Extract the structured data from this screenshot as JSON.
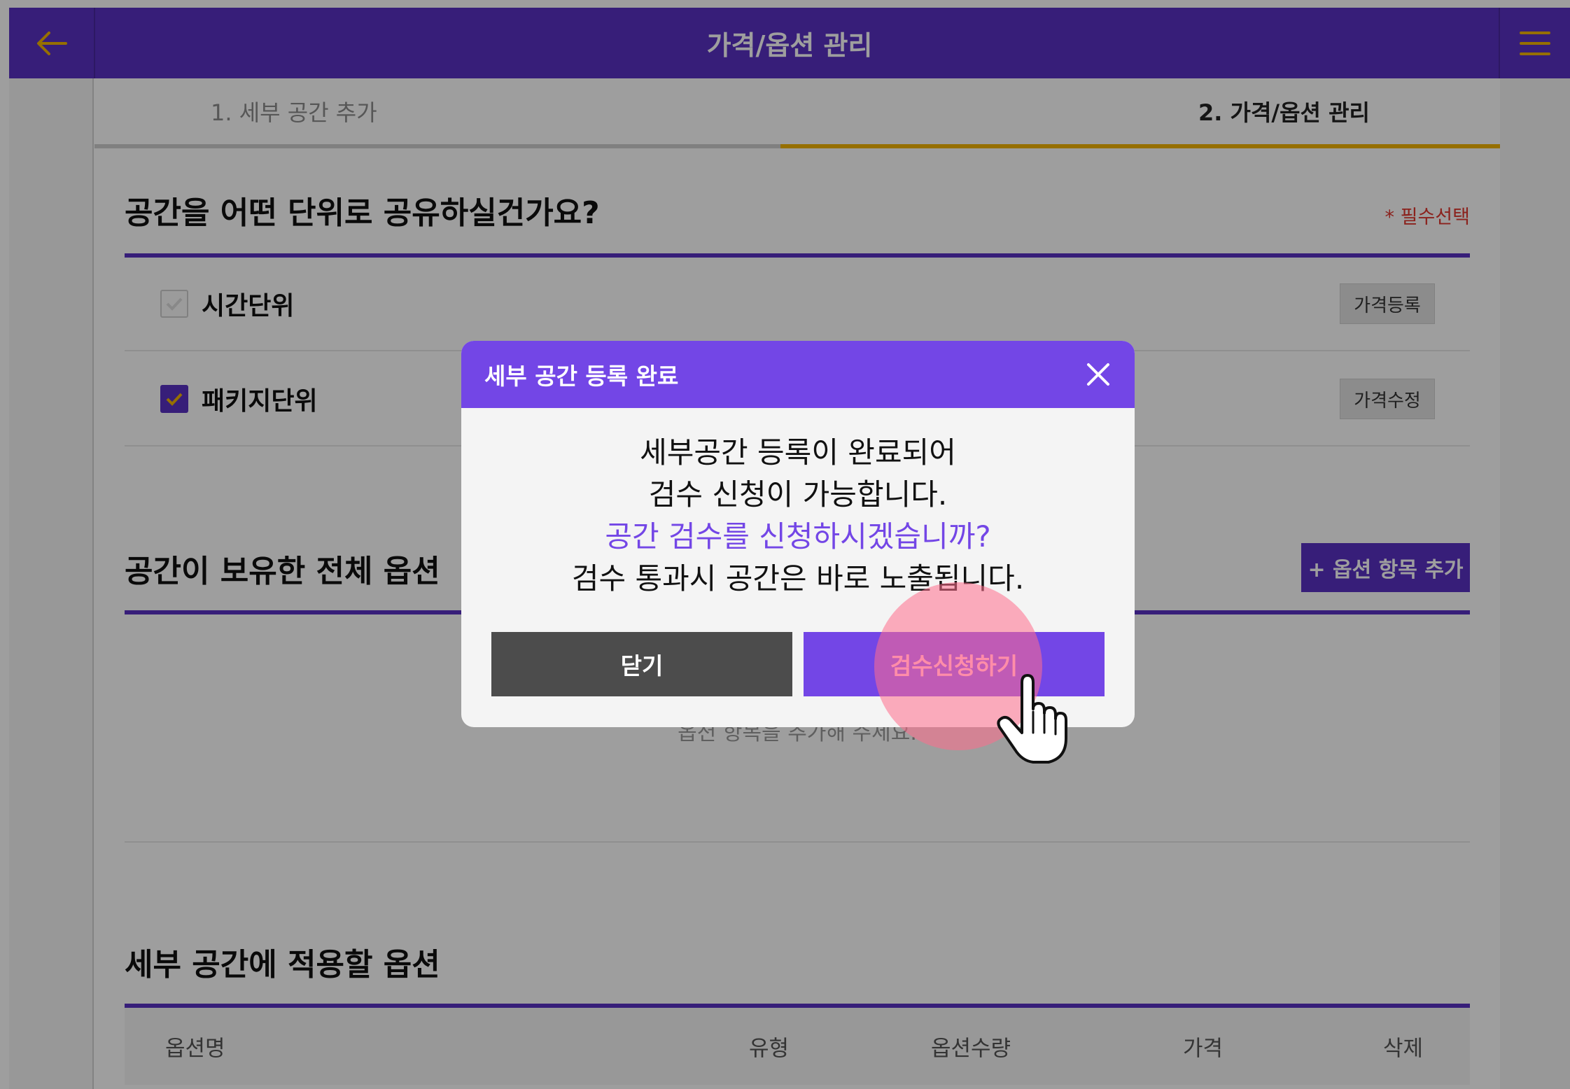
{
  "header": {
    "title": "가격/옵션 관리"
  },
  "steps": [
    {
      "label": "1. 세부 공간 추가",
      "active": false
    },
    {
      "label": "2. 가격/옵션 관리",
      "active": true
    }
  ],
  "share_unit": {
    "title": "공간을 어떤 단위로 공유하실건가요?",
    "required_note": "* 필수선택",
    "rows": [
      {
        "label": "시간단위",
        "checked": false,
        "button": "가격등록"
      },
      {
        "label": "패키지단위",
        "checked": true,
        "button": "가격수정"
      }
    ]
  },
  "all_options": {
    "title": "공간이 보유한 전체 옵션",
    "add_button": "+ 옵션 항목 추가",
    "empty_text": "옵션 항목을 추가해 주세요."
  },
  "applied_options": {
    "title": "세부 공간에 적용할 옵션",
    "columns": [
      "옵션명",
      "유형",
      "옵션수량",
      "가격",
      "삭제"
    ]
  },
  "modal": {
    "title": "세부 공간 등록 완료",
    "lines": [
      "세부공간 등록이 완료되어",
      "검수 신청이 가능합니다.",
      "공간 검수를 신청하시겠습니까?",
      "검수 통과시 공간은 바로 노출됩니다."
    ],
    "close_button": "닫기",
    "confirm_button": "검수신청하기"
  },
  "icons": [
    "back-arrow-icon",
    "menu-icon",
    "check-icon",
    "close-icon",
    "hand-pointer-icon"
  ],
  "colors": {
    "primary": "#5a31c4",
    "modal_accent": "#7346e6",
    "step_active": "#f2b400",
    "required": "#e0382f"
  }
}
